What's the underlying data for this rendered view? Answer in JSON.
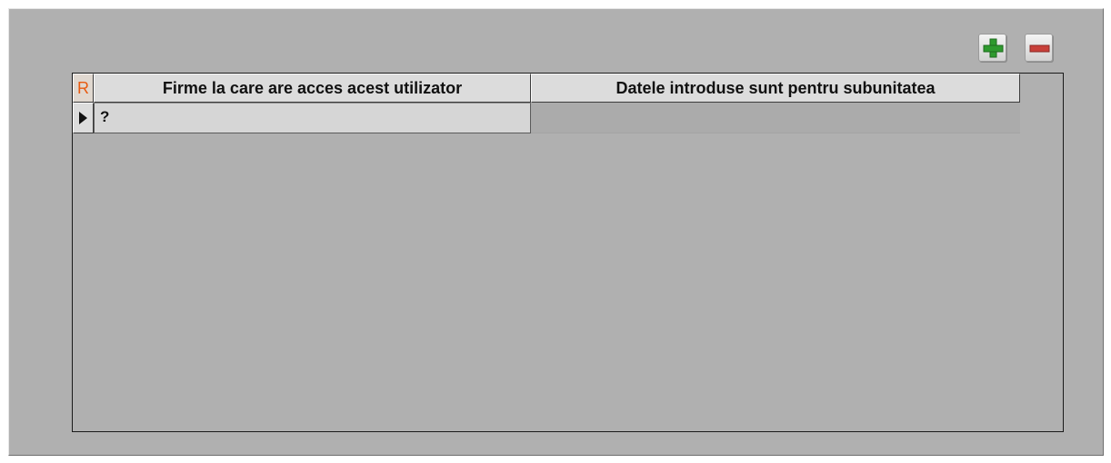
{
  "toolbar": {
    "add_icon": "plus-icon",
    "remove_icon": "minus-icon",
    "add_color": "#2e9a2e",
    "remove_color": "#c8403a"
  },
  "grid": {
    "record_indicator_label": "R",
    "columns": [
      "Firme la care are acces acest utilizator",
      "Datele introduse sunt pentru subunitatea"
    ],
    "rows": [
      {
        "firma": "?",
        "subunitate": ""
      }
    ],
    "current_row_icon": "row-pointer-icon"
  }
}
